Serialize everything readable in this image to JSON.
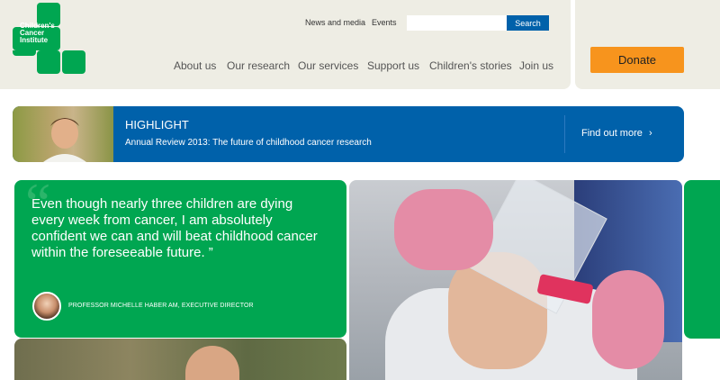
{
  "header": {
    "logo_lines": [
      "Children's",
      "Cancer",
      "Institute"
    ],
    "utility_links": [
      "News and media",
      "Events"
    ],
    "search": {
      "placeholder": "",
      "button_label": "Search"
    },
    "nav": [
      "About us",
      "Our research",
      "Our services",
      "Support us",
      "Children's stories",
      "Join us"
    ],
    "donate_label": "Donate"
  },
  "banner": {
    "title": "HIGHLIGHT",
    "subtitle": "Annual Review 2013: The future of childhood cancer research",
    "link_label": "Find out more",
    "link_arrow": "›"
  },
  "quote": {
    "text": "Even though nearly three children are dying every week from cancer, I am absolutely confident we can and will beat childhood cancer within the foreseeable future. ”",
    "attribution": "PROFESSOR MICHELLE HABER AM, EXECUTIVE DIRECTOR"
  },
  "colors": {
    "brand_green": "#00a651",
    "brand_blue": "#0061aa",
    "donate_orange": "#f7941d",
    "header_bg": "#eeede4"
  }
}
